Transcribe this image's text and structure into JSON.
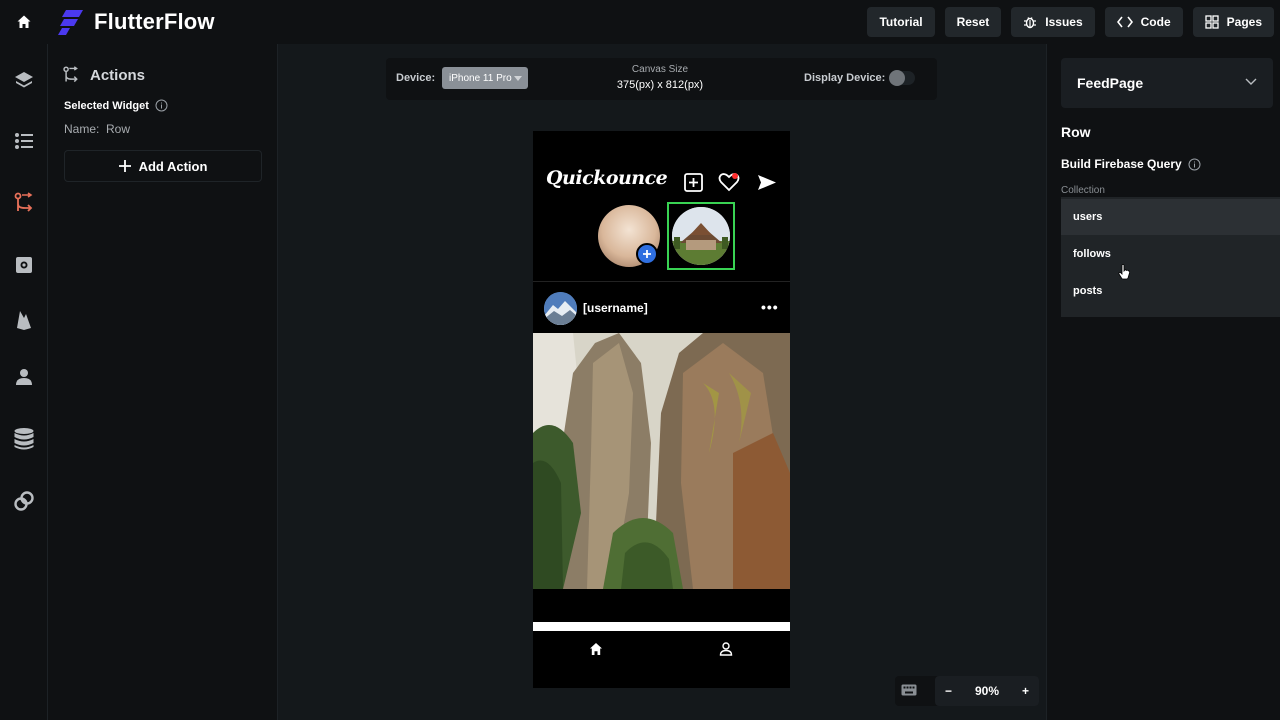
{
  "app": {
    "brand": "FlutterFlow",
    "brand_color": "#4b39ef"
  },
  "topbar": {
    "buttons": [
      {
        "label": "Tutorial",
        "icon": ""
      },
      {
        "label": "Reset",
        "icon": ""
      },
      {
        "label": "Issues",
        "icon": "bug-icon"
      },
      {
        "label": "Code",
        "icon": "code-icon"
      },
      {
        "label": "Pages",
        "icon": "grid-icon"
      }
    ]
  },
  "left_rail": {
    "items": [
      "layers-icon",
      "widget-tree-icon",
      "actions-icon",
      "settings-icon",
      "firebase-icon",
      "user-icon",
      "database-icon",
      "api-icon"
    ],
    "active_color": "#e8715a"
  },
  "actions_panel": {
    "title": "Actions",
    "selected_widget_label": "Selected Widget",
    "name_label": "Name:",
    "name_value": "Row",
    "add_action_label": "Add Action"
  },
  "canvas": {
    "device_label": "Device:",
    "device_value": "iPhone 11 Pro",
    "canvas_size_label": "Canvas Size",
    "canvas_size_value": "375(px) x 812(px)",
    "display_device_label": "Display Device:",
    "zoom_value": "90%",
    "zoom_minus": "−",
    "zoom_plus": "+"
  },
  "phone": {
    "app_title": "Quickounce",
    "username": "[username]",
    "more": "•••",
    "story_border_color": "#39d353"
  },
  "right_panel": {
    "page_name": "FeedPage",
    "widget_type": "Row",
    "query_label": "Build Firebase Query",
    "collection_label": "Collection",
    "collections": [
      "users",
      "follows",
      "posts"
    ]
  }
}
